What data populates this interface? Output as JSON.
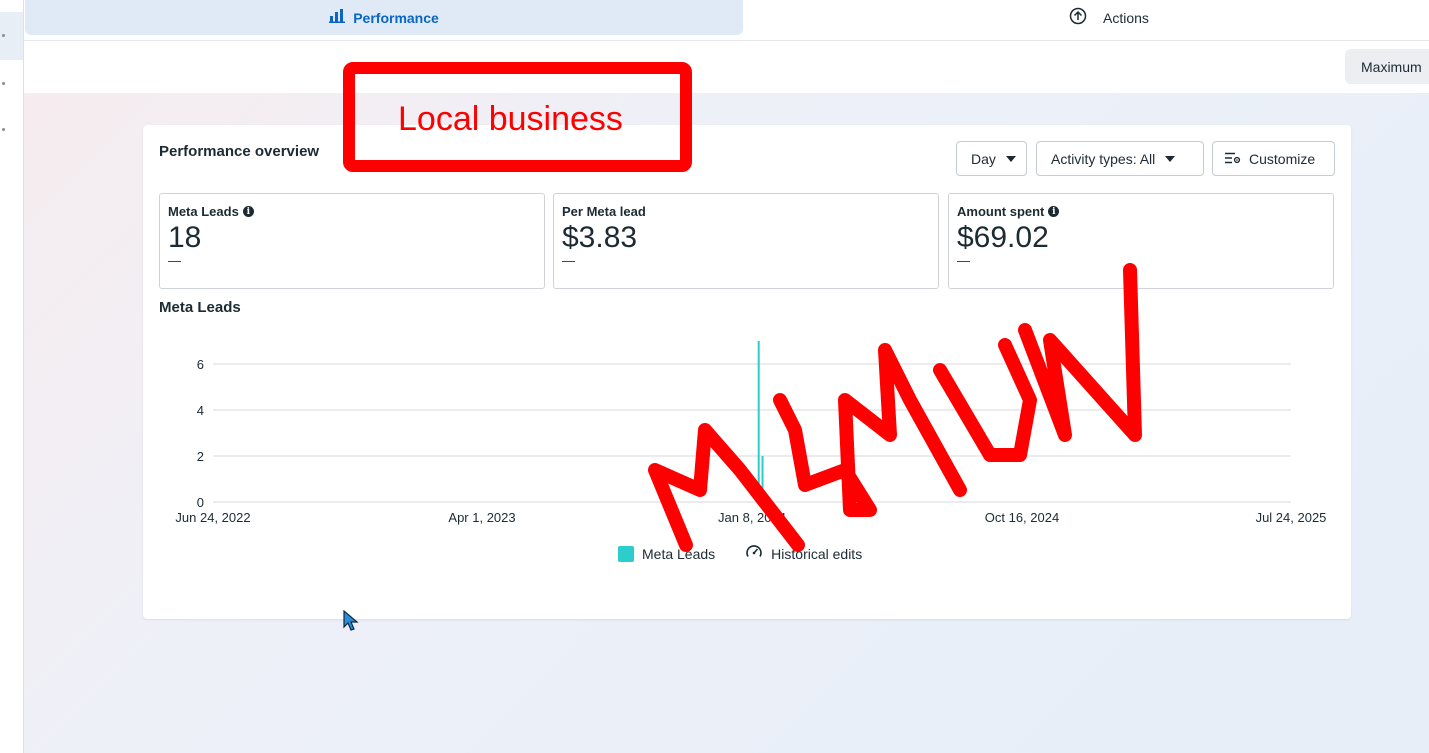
{
  "tabs": {
    "performance_label": "Performance",
    "actions_label": "Actions"
  },
  "date_range": {
    "label": "Maximum"
  },
  "card": {
    "title": "Performance overview",
    "controls": {
      "day": "Day",
      "activity": "Activity types: All",
      "customize": "Customize"
    },
    "metrics": [
      {
        "label": "Meta Leads",
        "value": "18",
        "change": "—",
        "info": true
      },
      {
        "label": "Per Meta lead",
        "value": "$3.83",
        "change": "—",
        "info": false
      },
      {
        "label": "Amount spent",
        "value": "$69.02",
        "change": "—",
        "info": true
      }
    ]
  },
  "annotations": {
    "box_text": "Local business",
    "scribble_text": "MAMUN",
    "color": "#ff0000"
  },
  "chart_data": {
    "type": "bar",
    "title": "Meta Leads",
    "x_tick_labels": [
      "Jun 24, 2022",
      "Apr 1, 2023",
      "Jan 8, 2024",
      "Oct 16, 2024",
      "Jul 24, 2025"
    ],
    "y_ticks": [
      0,
      2,
      4,
      6
    ],
    "ylim": [
      0,
      6
    ],
    "series": [
      {
        "name": "Meta Leads",
        "color": "#2ccdca",
        "points": [
          {
            "x": "2024-01-15",
            "y": 7
          },
          {
            "x": "2024-01-19",
            "y": 2
          }
        ]
      }
    ],
    "legend": [
      "Meta Leads",
      "Historical edits"
    ],
    "legend_position": "bottom",
    "grid": true
  }
}
